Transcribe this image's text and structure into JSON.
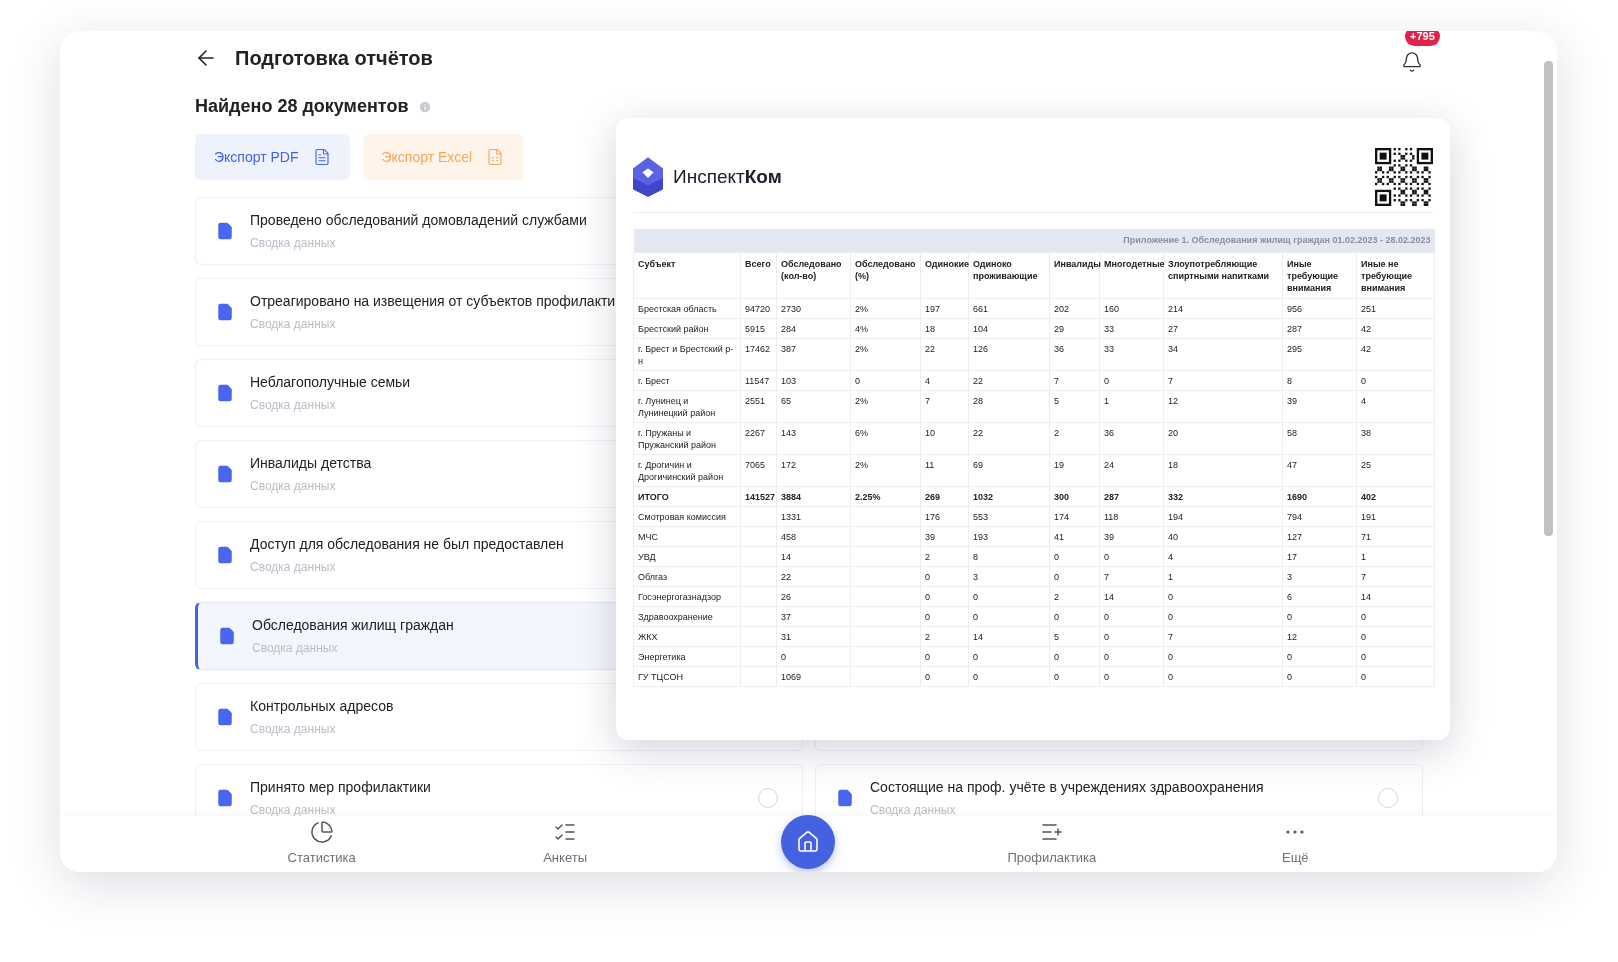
{
  "header": {
    "title": "Подготовка отчётов",
    "notifications": "+795"
  },
  "found": "Найдено 28 документов",
  "exports": [
    {
      "kind": "pdf",
      "label": "Экспорт PDF"
    },
    {
      "kind": "excel",
      "label": "Экспорт Excel"
    }
  ],
  "left_column": [
    {
      "title": "Проведено обследований домовладений службами",
      "subtitle": "Сводка данных",
      "selected": false
    },
    {
      "title": "Отреагировано на извещения от субъектов профилакти",
      "subtitle": "Сводка данных",
      "selected": false
    },
    {
      "title": "Неблагополучные семьи",
      "subtitle": "Сводка данных",
      "selected": false
    },
    {
      "title": "Инвалиды детства",
      "subtitle": "Сводка данных",
      "selected": false
    },
    {
      "title": "Доступ для обследования не был предоставлен",
      "subtitle": "Сводка данных",
      "selected": false
    },
    {
      "title": "Обследования жилищ граждан",
      "subtitle": "Сводка данных",
      "selected": true
    },
    {
      "title": "Контрольных адресов",
      "subtitle": "Сводка данных",
      "selected": false
    },
    {
      "title": "Принято мер профилактики",
      "subtitle": "Сводка данных",
      "selected": false,
      "checked": false
    }
  ],
  "right_column": [
    {
      "title": "Состоящие на проф. учёте в учреждениях здравоохранения",
      "subtitle": "Сводка данных",
      "selected": false,
      "checked": false
    }
  ],
  "preview": {
    "logo": "Инспект**Ком**",
    "caption": "Приложение 1. Обследования жилищ граждан 01.02.2023 - 28.02.2023",
    "columns": [
      "Субъект",
      "Всего",
      "Обследовано (кол-во)",
      "Обследовано (%)",
      "Одинокие",
      "Одиноко проживающие",
      "Инвалиды",
      "Многодетные",
      "Злоупотребляющие спиртными напитками",
      "Иные требующие внимания",
      "Иные не требующие внимания"
    ],
    "rows": [
      {
        "kind": "data",
        "cells": [
          "Брестская область",
          "94720",
          "2730",
          "2%",
          "197",
          "661",
          "202",
          "160",
          "214",
          "956",
          "251"
        ]
      },
      {
        "kind": "data",
        "cells": [
          "Брестский район",
          "5915",
          "284",
          "4%",
          "18",
          "104",
          "29",
          "33",
          "27",
          "287",
          "42"
        ]
      },
      {
        "kind": "data",
        "cells": [
          "г. Брест и Брестский р-н",
          "17462",
          "387",
          "2%",
          "22",
          "126",
          "36",
          "33",
          "34",
          "295",
          "42"
        ]
      },
      {
        "kind": "data",
        "cells": [
          "г. Брест",
          "11547",
          "103",
          "0",
          "4",
          "22",
          "7",
          "0",
          "7",
          "8",
          "0"
        ]
      },
      {
        "kind": "data",
        "cells": [
          "г. Лунинец и Лунинецкий район",
          "2551",
          "65",
          "2%",
          "7",
          "28",
          "5",
          "1",
          "12",
          "39",
          "4"
        ]
      },
      {
        "kind": "data",
        "cells": [
          "г. Пружаны и Пружанский район",
          "2267",
          "143",
          "6%",
          "10",
          "22",
          "2",
          "36",
          "20",
          "58",
          "38"
        ]
      },
      {
        "kind": "data",
        "cells": [
          "г. Дрогичин и Дрогичинский район",
          "7065",
          "172",
          "2%",
          "11",
          "69",
          "19",
          "24",
          "18",
          "47",
          "25"
        ]
      },
      {
        "kind": "total",
        "cells": [
          "ИТОГО",
          "141527",
          "3884",
          "2.25%",
          "269",
          "1032",
          "300",
          "287",
          "332",
          "1690",
          "402"
        ]
      },
      {
        "kind": "data",
        "cells": [
          "Смотровая комиссия",
          null,
          "1331",
          null,
          "176",
          "553",
          "174",
          "118",
          "194",
          "794",
          "191"
        ]
      },
      {
        "kind": "data",
        "cells": [
          "МЧС",
          null,
          "458",
          null,
          "39",
          "193",
          "41",
          "39",
          "40",
          "127",
          "71"
        ]
      },
      {
        "kind": "data",
        "cells": [
          "УВД",
          null,
          "14",
          null,
          "2",
          "8",
          "0",
          "0",
          "4",
          "17",
          "1"
        ]
      },
      {
        "kind": "data",
        "cells": [
          "Облгаз",
          null,
          "22",
          null,
          "0",
          "3",
          "0",
          "7",
          "1",
          "3",
          "7"
        ]
      },
      {
        "kind": "data",
        "cells": [
          "Госэнергогазнадзор",
          null,
          "26",
          null,
          "0",
          "0",
          "2",
          "14",
          "0",
          "6",
          "14"
        ]
      },
      {
        "kind": "data",
        "cells": [
          "Здравоохранение",
          null,
          "37",
          null,
          "0",
          "0",
          "0",
          "0",
          "0",
          "0",
          "0"
        ]
      },
      {
        "kind": "data",
        "cells": [
          "ЖКХ",
          null,
          "31",
          null,
          "2",
          "14",
          "5",
          "0",
          "7",
          "12",
          "0"
        ]
      },
      {
        "kind": "data",
        "cells": [
          "Энергетика",
          null,
          "0",
          null,
          "0",
          "0",
          "0",
          "0",
          "0",
          "0",
          "0"
        ]
      },
      {
        "kind": "data",
        "cells": [
          "ГУ ТЦСОН",
          null,
          "1069",
          null,
          "0",
          "0",
          "0",
          "0",
          "0",
          "0",
          "0"
        ]
      }
    ]
  },
  "nav": [
    {
      "kind": "stats",
      "label": "Статистика"
    },
    {
      "kind": "forms",
      "label": "Анкеты"
    },
    {
      "kind": "home"
    },
    {
      "kind": "prevention",
      "label": "Профилактика"
    },
    {
      "kind": "more",
      "label": "Ещё"
    }
  ]
}
